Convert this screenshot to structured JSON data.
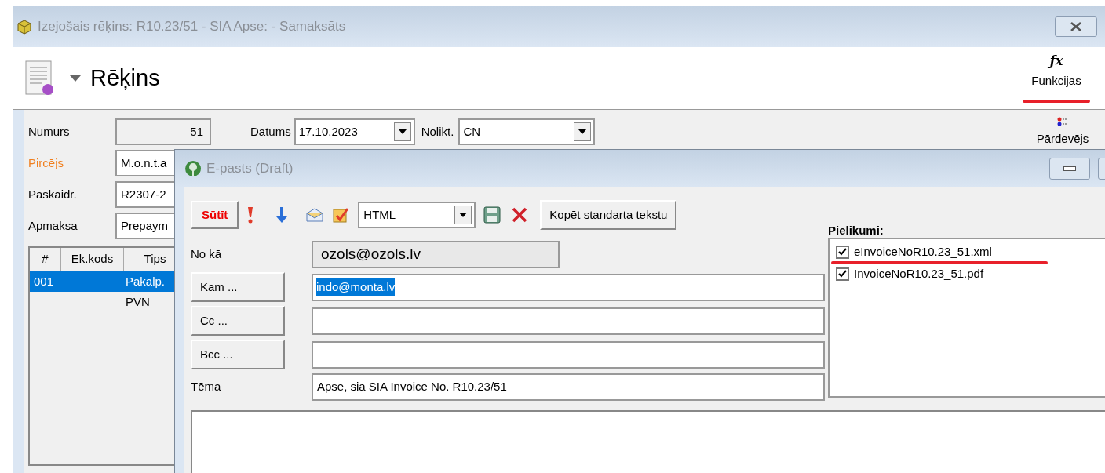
{
  "main_window": {
    "title": "Izejošais rēķins: R10.23/51 - SIA Apse:  - Samaksāts",
    "header": {
      "title": "Rēķins"
    },
    "functions": [
      {
        "icon": "ƒx",
        "label": "Funkcijas"
      },
      {
        "label": "Pārdevējs"
      }
    ],
    "form": {
      "numurs": {
        "label": "Numurs",
        "value": "51"
      },
      "datums": {
        "label": "Datums",
        "value": "17.10.2023"
      },
      "nolikt": {
        "label": "Nolikt.",
        "value": "CN"
      },
      "fields": [
        {
          "label": "Pircējs",
          "value": "M.o.n.t.a",
          "required": true
        },
        {
          "label": "Paskaidr.",
          "value": "R2307-2",
          "required": false
        },
        {
          "label": "Apmaksa",
          "value": "Prepaym",
          "required": false
        }
      ]
    },
    "table": {
      "columns": [
        "#",
        "Ek.kods",
        "Tips"
      ],
      "rows": [
        {
          "cells": [
            "001",
            "",
            "Pakalp."
          ],
          "selected": true
        },
        {
          "cells": [
            "",
            "",
            "PVN"
          ],
          "selected": false
        }
      ]
    }
  },
  "email_window": {
    "title": "E-pasts (Draft)",
    "toolbar": {
      "send": "Sūtīt",
      "format": "HTML",
      "copy": "Kopēt standarta tekstu"
    },
    "from": {
      "label": "No kā",
      "value": "ozols@ozols.lv"
    },
    "recipients": [
      {
        "button": "Kam ...",
        "value": "indo@monta.lv",
        "value_selected": true
      },
      {
        "button": "Cc ..."
      },
      {
        "button": "Bcc ..."
      }
    ],
    "subject": {
      "label": "Tēma",
      "value": "Apse, sia SIA Invoice No. R10.23/51"
    },
    "attachments": {
      "label": "Pielikumi:",
      "items": [
        {
          "name": "eInvoiceNoR10.23_51.xml",
          "checked": true
        },
        {
          "name": "InvoiceNoR10.23_51.pdf",
          "checked": true
        }
      ]
    }
  }
}
